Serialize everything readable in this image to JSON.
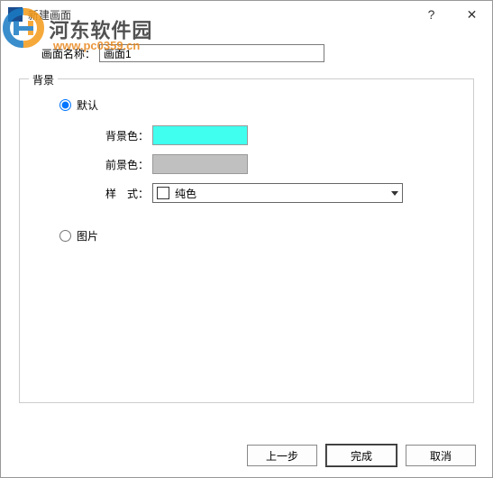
{
  "window": {
    "title": "新建画面"
  },
  "watermark": {
    "brand": "河东软件园",
    "url": "www.pc0359.cn"
  },
  "form": {
    "name_label": "画面名称：",
    "name_value": "画面1"
  },
  "group": {
    "title": "背景",
    "radio_default": "默认",
    "radio_image": "图片",
    "bgcolor_label": "背景色：",
    "fgcolor_label": "前景色：",
    "style_label": "样　式：",
    "style_value": "纯色",
    "bgcolor": "#40ffef",
    "fgcolor": "#c0c0c0"
  },
  "buttons": {
    "prev": "上一步",
    "finish": "完成",
    "cancel": "取消"
  }
}
